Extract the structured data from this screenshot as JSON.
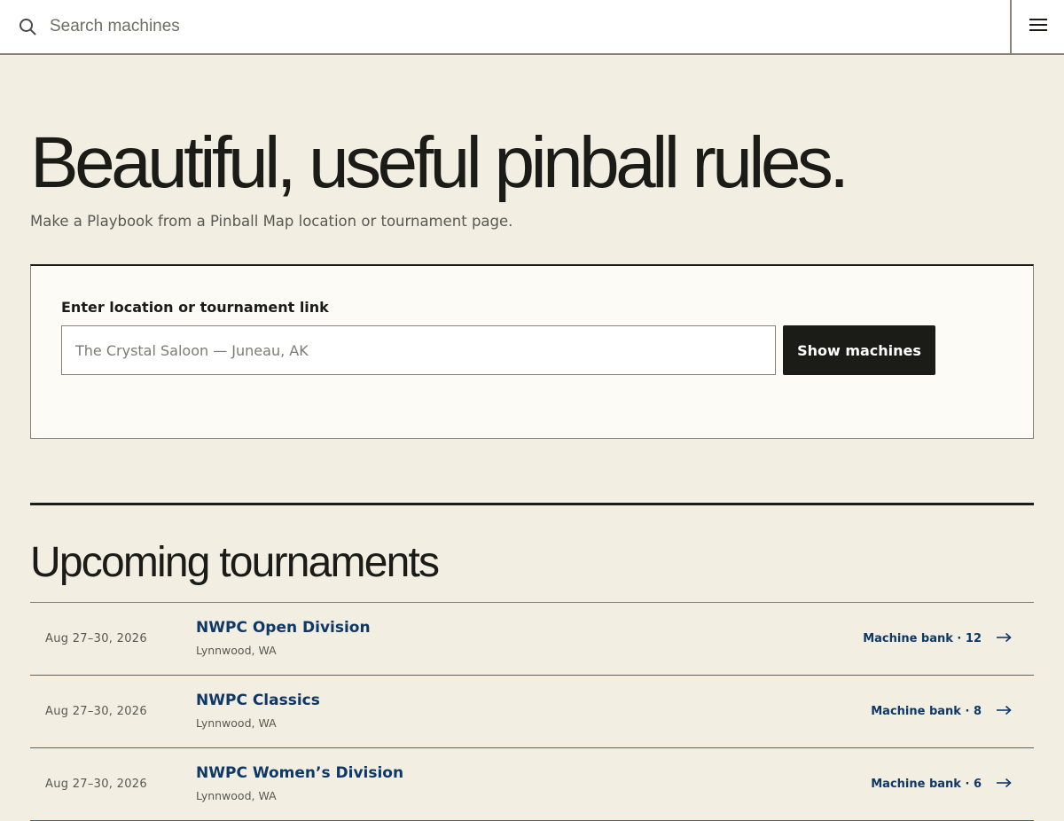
{
  "search": {
    "placeholder": "Search machines"
  },
  "hero": {
    "title": "Beautiful, useful pinball rules.",
    "subtitle": "Make a Playbook from a Pinball Map location or tournament page."
  },
  "form": {
    "label": "Enter location or tournament link",
    "placeholder": "The Crystal Saloon — Juneau, AK",
    "button_label": "Show machines"
  },
  "tournaments": {
    "heading": "Upcoming tournaments",
    "items": [
      {
        "date": "Aug 27–30, 2026",
        "name": "NWPC Open Division",
        "location": "Lynnwood, WA",
        "bank": "Machine bank · 12"
      },
      {
        "date": "Aug 27–30, 2026",
        "name": "NWPC Classics",
        "location": "Lynnwood, WA",
        "bank": "Machine bank · 8"
      },
      {
        "date": "Aug 27–30, 2026",
        "name": "NWPC Women’s Division",
        "location": "Lynnwood, WA",
        "bank": "Machine bank · 6"
      }
    ]
  },
  "icons": {
    "search": "search-icon",
    "menu": "hamburger-menu-icon",
    "row_arrow": "arrow-right-icon"
  },
  "colors": {
    "page_background": "#f2eee2",
    "card_background": "#fcfbf6",
    "primary_text": "#1b1b18",
    "link_blue": "#0e3868",
    "button_background": "#1b1b18"
  }
}
